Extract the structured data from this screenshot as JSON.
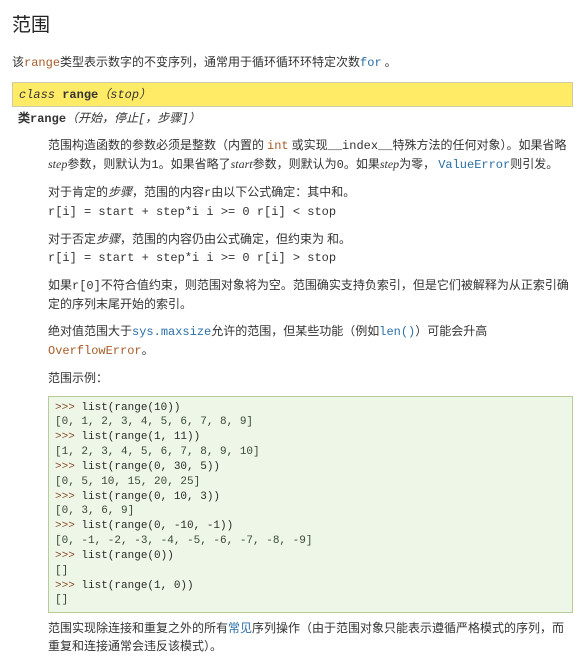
{
  "title": "范围",
  "intro": {
    "t1": "该",
    "range": "range",
    "t2": "类型表示数字的不变序列，通常用于循环循环环特定次数",
    "forkw": "for",
    "t3": " 。"
  },
  "sig1": {
    "cls": "class ",
    "name": "range",
    "open": "（",
    "arg": "stop",
    "close": "）"
  },
  "sig2": {
    "cls": "类",
    "name": "range",
    "open": "（",
    "p1": "开始",
    "c1": "，",
    "p2": "停止",
    "lb": "[",
    "c2": "，",
    "p3": "步骤",
    "rb": "]",
    "close": "）"
  },
  "para1": {
    "t1": "范围构造函数的参数必须是整数（内置的 ",
    "int": "int",
    "t2": "或实现",
    "index": "__index__",
    "t3": "特殊方法的任何对象）。如果省略",
    "step": "step",
    "t4": "参数，则默认为",
    "one": "1",
    "t5": "。如果省略了",
    "start": "start",
    "t6": "参数，则默认为",
    "zero": "0",
    "t7": "。如果",
    "step2": "step",
    "t8": "为零，",
    "verr": "ValueError",
    "t9": "则引发。"
  },
  "para2": {
    "t1": "对于肯定的",
    "step": "步骤",
    "t2": "，范围的内容",
    "r": "r",
    "t3": "由以下公式确定：其中和。",
    "code": "r[i] = start + step*i i >= 0 r[i] < stop"
  },
  "para3": {
    "t1": "对于否定",
    "step": "步骤",
    "t2": "，范围的内容仍由公式确定，但约束为 和。",
    "code": "r[i] = start + step*i i >= 0 r[i] > stop"
  },
  "para4": {
    "t1": "如果",
    "r0": "r[0]",
    "t2": "不符合值约束，则范围对象将为空。范围确实支持负索引，但是它们被解释为从正索引确定的序列末尾开始的索引。"
  },
  "para5": {
    "t1": "绝对值范围大于",
    "sysmax": "sys.maxsize",
    "t2": "允许的范围，但某些功能（例如",
    "len": "len()",
    "t3": "）可能会升高 ",
    "ovf": "OverflowError",
    "dot": "。"
  },
  "examples_label": "范围示例：",
  "code": {
    "lines": [
      {
        "prompt": ">>> ",
        "src": "list(range(10))"
      },
      {
        "out": "[0, 1, 2, 3, 4, 5, 6, 7, 8, 9]"
      },
      {
        "prompt": ">>> ",
        "src": "list(range(1, 11))"
      },
      {
        "out": "[1, 2, 3, 4, 5, 6, 7, 8, 9, 10]"
      },
      {
        "prompt": ">>> ",
        "src": "list(range(0, 30, 5))"
      },
      {
        "out": "[0, 5, 10, 15, 20, 25]"
      },
      {
        "prompt": ">>> ",
        "src": "list(range(0, 10, 3))"
      },
      {
        "out": "[0, 3, 6, 9]"
      },
      {
        "prompt": ">>> ",
        "src": "list(range(0, -10, -1))"
      },
      {
        "out": "[0, -1, -2, -3, -4, -5, -6, -7, -8, -9]"
      },
      {
        "prompt": ">>> ",
        "src": "list(range(0))"
      },
      {
        "out": "[]"
      },
      {
        "prompt": ">>> ",
        "src": "list(range(1, 0))"
      },
      {
        "out": "[]"
      }
    ]
  },
  "para6": {
    "t1": "范围实现除连接和重复之外的所有",
    "common": "常见",
    "t2": "序列操作（由于范围对象只能表示遵循严格模式的序列，而重复和连接通常会违反该模式）。"
  }
}
